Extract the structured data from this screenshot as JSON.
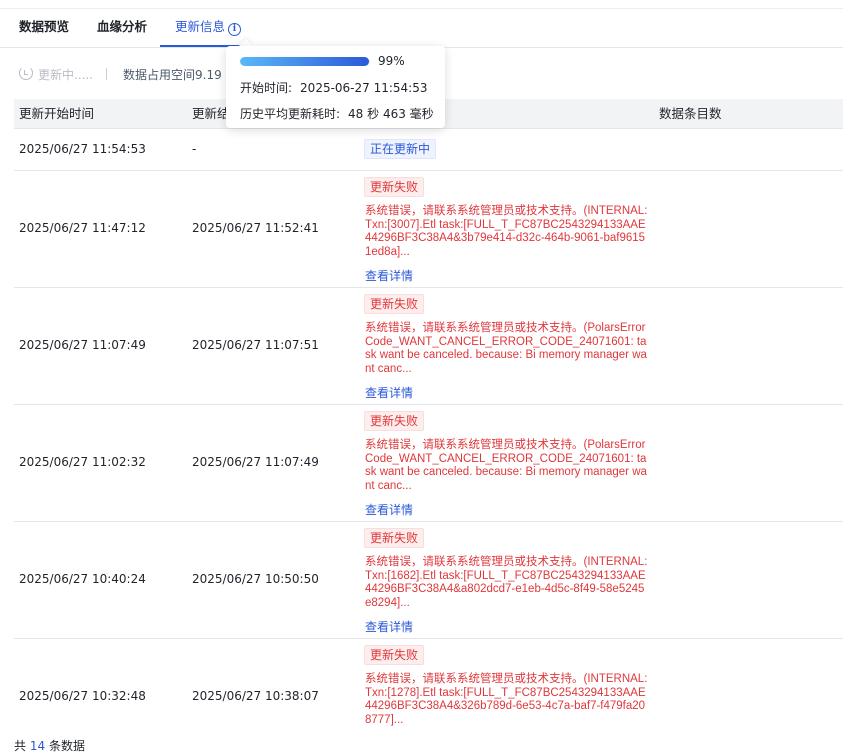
{
  "tabs": [
    {
      "label": "数据预览"
    },
    {
      "label": "血缘分析"
    },
    {
      "label": "更新信息",
      "info_icon": "i"
    }
  ],
  "toolbar": {
    "refresh_label": "更新中.....",
    "space_label": "数据占用空间9.19 G"
  },
  "tooltip": {
    "progress": 0.99,
    "percent_label": "99%",
    "start_label": "开始时间:",
    "start_value": "2025-06-27 11:54:53",
    "avg_label": "历史平均更新耗时:",
    "avg_value": "48 秒 463 毫秒"
  },
  "table": {
    "headers": {
      "start": "更新开始时间",
      "end": "更新结",
      "status": "",
      "count": "数据条目数"
    },
    "rows": [
      {
        "start": "2025/06/27 11:54:53",
        "end": "-",
        "status": "正在更新中",
        "error_text": "",
        "detail": ""
      },
      {
        "start": "2025/06/27 11:47:12",
        "end": "2025/06/27 11:52:41",
        "status": "更新失败",
        "error_text": "系统错误，请联系系统管理员或技术支持。(INTERNAL: Txn:[3007].Etl task:[FULL_T_FC87BC2543294133AAE44296BF3C38A4&3b79e414-d32c-464b-9061-baf96151ed8a]...",
        "detail": "查看详情"
      },
      {
        "start": "2025/06/27 11:07:49",
        "end": "2025/06/27 11:07:51",
        "status": "更新失败",
        "error_text": "系统错误，请联系系统管理员或技术支持。(PolarsErrorCode_WANT_CANCEL_ERROR_CODE_24071601: task want be canceled. because: Bi memory manager want canc...",
        "detail": "查看详情"
      },
      {
        "start": "2025/06/27 11:02:32",
        "end": "2025/06/27 11:07:49",
        "status": "更新失败",
        "error_text": "系统错误，请联系系统管理员或技术支持。(PolarsErrorCode_WANT_CANCEL_ERROR_CODE_24071601: task want be canceled. because: Bi memory manager want canc...",
        "detail": "查看详情"
      },
      {
        "start": "2025/06/27 10:40:24",
        "end": "2025/06/27 10:50:50",
        "status": "更新失败",
        "error_text": "系统错误，请联系系统管理员或技术支持。(INTERNAL: Txn:[1682].Etl task:[FULL_T_FC87BC2543294133AAE44296BF3C38A4&a802dcd7-e1eb-4d5c-8f49-58e5245e8294]...",
        "detail": "查看详情"
      },
      {
        "start": "2025/06/27 10:32:48",
        "end": "2025/06/27 10:38:07",
        "status": "更新失败",
        "error_text": "系统错误，请联系系统管理员或技术支持。(INTERNAL: Txn:[1278].Etl task:[FULL_T_FC87BC2543294133AAE44296BF3C38A4&326b789d-6e53-4c7a-baf7-f479fa208777]...",
        "detail": "查看详情"
      }
    ]
  },
  "footer": {
    "prefix": "共",
    "count": "14",
    "suffix": "条数据"
  },
  "colors": {
    "accent": "#2b59d8",
    "error": "#e0373b",
    "header_bg": "#f2f3f5"
  }
}
